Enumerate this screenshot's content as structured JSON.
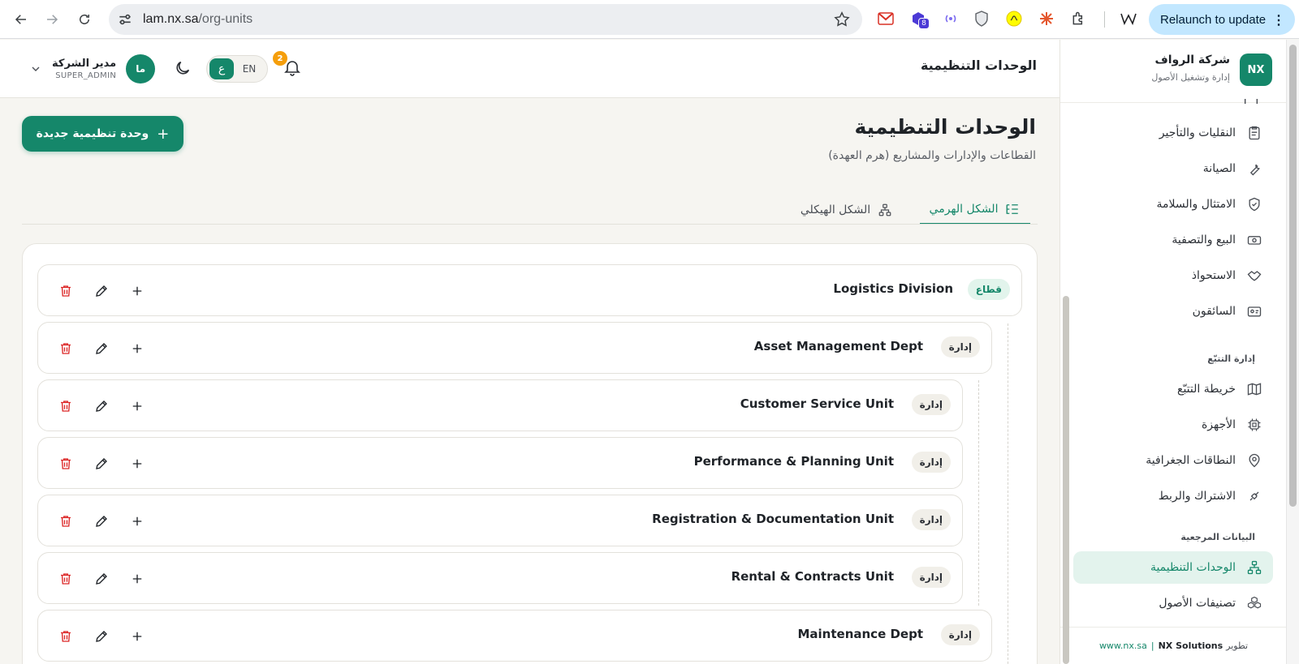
{
  "browser": {
    "url_host": "lam.nx.sa",
    "url_path": "/org-units",
    "relaunch_label": "Relaunch to update",
    "ext_badge": "8"
  },
  "header": {
    "title": "الوحدات التنظيمية",
    "user_name": "مدير الشركة",
    "user_role": "SUPER_ADMIN",
    "avatar_initials": "ما",
    "lang_ar": "ع",
    "lang_en": "EN",
    "notif_count": "2"
  },
  "brand": {
    "logo": "NX",
    "name": "شركة الرواف",
    "subtitle": "إدارة وتشغيل الأصول"
  },
  "sidebar": {
    "items": [
      {
        "label": "النقليات والتأجير",
        "icon": "clipboard-icon"
      },
      {
        "label": "الصيانة",
        "icon": "wrench-icon"
      },
      {
        "label": "الامتثال والسلامة",
        "icon": "shield-check-icon"
      },
      {
        "label": "البيع والتصفية",
        "icon": "banknote-icon"
      },
      {
        "label": "الاستحواذ",
        "icon": "handshake-icon"
      },
      {
        "label": "السائقون",
        "icon": "id-card-icon"
      }
    ],
    "section_tracking": "إدارة التتبّع",
    "tracking_items": [
      {
        "label": "خريطة التتبّع",
        "icon": "map-icon"
      },
      {
        "label": "الأجهزة",
        "icon": "cpu-icon"
      },
      {
        "label": "النطاقات الجغرافية",
        "icon": "map-pin-icon"
      },
      {
        "label": "الاشتراك والربط",
        "icon": "plug-icon"
      }
    ],
    "section_reference": "البيانات المرجعية",
    "reference_items": [
      {
        "label": "الوحدات التنظيمية",
        "icon": "org-chart-icon",
        "active": true
      },
      {
        "label": "تصنيفات الأصول",
        "icon": "boxes-icon"
      }
    ],
    "footer": {
      "dev_label": "تطوير",
      "company": "NX Solutions",
      "separator": "|",
      "site": "www.nx.sa"
    }
  },
  "main": {
    "title": "الوحدات التنظيمية",
    "subtitle": "القطاعات والإدارات والمشاريع (هرم العهدة)",
    "new_button": "وحدة تنظيمية جديدة",
    "tabs": [
      {
        "label": "الشكل الهرمي",
        "active": true
      },
      {
        "label": "الشكل الهيكلي",
        "active": false
      }
    ],
    "units": [
      {
        "name": "Logistics Division",
        "type": "قطاع",
        "level": 0
      },
      {
        "name": "Asset Management Dept",
        "type": "إدارة",
        "level": 1
      },
      {
        "name": "Customer Service Unit",
        "type": "إدارة",
        "level": 2
      },
      {
        "name": "Performance & Planning Unit",
        "type": "إدارة",
        "level": 2
      },
      {
        "name": "Registration & Documentation Unit",
        "type": "إدارة",
        "level": 2
      },
      {
        "name": "Rental & Contracts Unit",
        "type": "إدارة",
        "level": 2
      },
      {
        "name": "Maintenance Dept",
        "type": "إدارة",
        "level": 1
      }
    ]
  },
  "colors": {
    "primary": "#15876a",
    "danger": "#dc2626",
    "badge_warning": "#f59e0b",
    "background": "#f6f5f1"
  }
}
